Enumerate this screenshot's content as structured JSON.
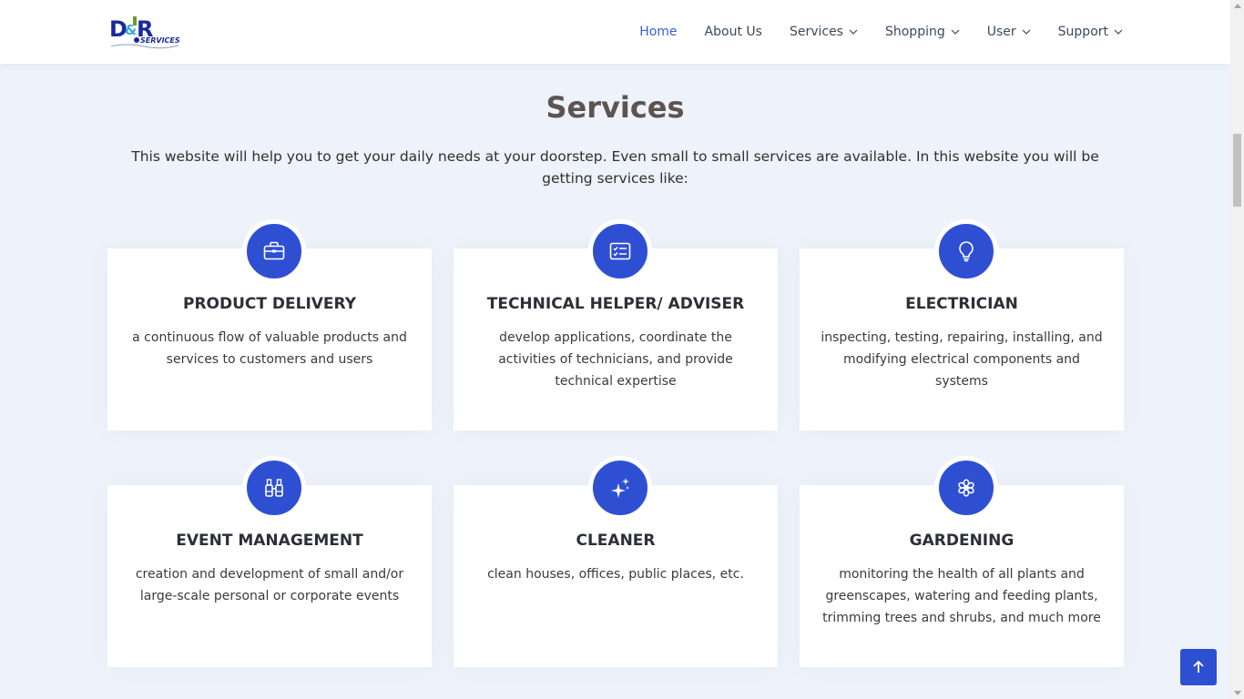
{
  "header": {
    "logo_text": "D&R SERVICES",
    "nav": [
      {
        "label": "Home",
        "active": true,
        "dropdown": false
      },
      {
        "label": "About Us",
        "active": false,
        "dropdown": false
      },
      {
        "label": "Services",
        "active": false,
        "dropdown": true
      },
      {
        "label": "Shopping",
        "active": false,
        "dropdown": true
      },
      {
        "label": "User",
        "active": false,
        "dropdown": true
      },
      {
        "label": "Support",
        "active": false,
        "dropdown": true
      }
    ]
  },
  "services": {
    "title": "Services",
    "description": "This website will help you to get your daily needs at your doorstep. Even small to small services are available. In this website you will be getting services like:",
    "cards": [
      {
        "icon": "briefcase-icon",
        "title": "PRODUCT DELIVERY",
        "text": "a continuous flow of valuable products and services to customers and users"
      },
      {
        "icon": "card-checklist-icon",
        "title": "TECHNICAL HELPER/ ADVISER",
        "text": "develop applications, coordinate the activities of technicians, and provide technical expertise"
      },
      {
        "icon": "lightbulb-icon",
        "title": "ELECTRICIAN",
        "text": "inspecting, testing, repairing, installing, and modifying electrical components and systems"
      },
      {
        "icon": "binoculars-icon",
        "title": "EVENT MANAGEMENT",
        "text": "creation and development of small and/or large-scale personal or corporate events"
      },
      {
        "icon": "stars-icon",
        "title": "CLEANER",
        "text": "clean houses, offices, public places, etc."
      },
      {
        "icon": "flower-icon",
        "title": "GARDENING",
        "text": "monitoring the health of all plants and greenscapes, watering and feeding plants, trimming trees and shrubs, and much more"
      }
    ]
  },
  "colors": {
    "accent": "#2f4fd3",
    "nav_active": "#3b5bdb",
    "page_bg": "#eef2fb"
  },
  "back_to_top": {
    "icon": "arrow-up-icon"
  }
}
